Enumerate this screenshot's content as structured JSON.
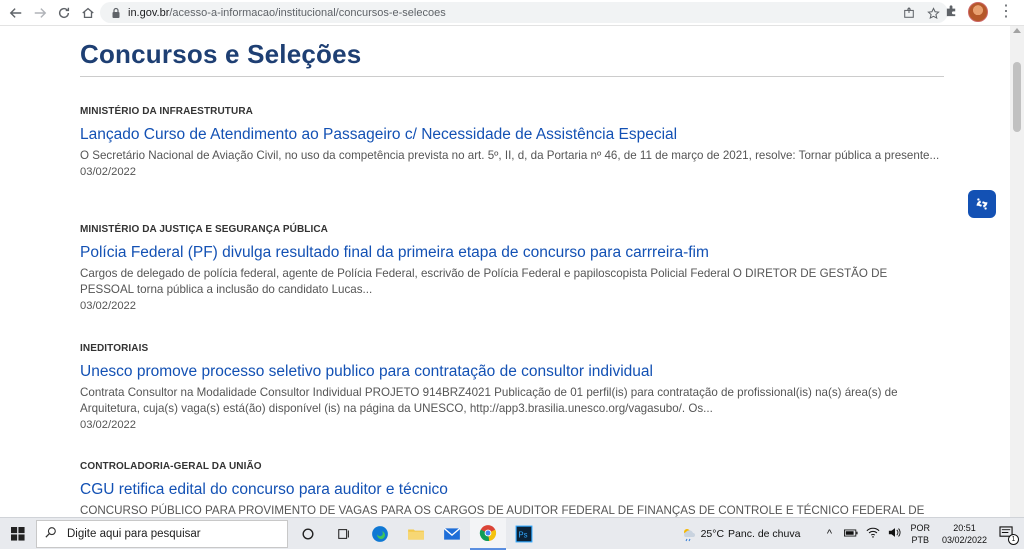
{
  "browser": {
    "url_host": "in.gov.br",
    "url_path": "/acesso-a-informacao/institucional/concursos-e-selecoes"
  },
  "page": {
    "title": "Concursos e Seleções"
  },
  "items": [
    {
      "category": "MINISTÉRIO DA INFRAESTRUTURA",
      "headline": "Lançado Curso de Atendimento ao Passageiro c/ Necessidade de Assistência Especial",
      "summary": "O Secretário Nacional de Aviação Civil, no uso da competência prevista no art. 5º, II, d, da Portaria nº 46, de 11 de março de 2021, resolve: Tornar pública a presente...",
      "date": "03/02/2022"
    },
    {
      "category": "MINISTÉRIO DA JUSTIÇA E SEGURANÇA PÚBLICA",
      "headline": "Polícia Federal (PF) divulga resultado final da primeira etapa de concurso para carrreira-fim",
      "summary": "Cargos de delegado de polícia federal, agente de Polícia Federal, escrivão de Polícia Federal e papiloscopista Policial Federal O DIRETOR DE GESTÃO DE PESSOAL torna pública a inclusão do candidato Lucas...",
      "date": "03/02/2022"
    },
    {
      "category": "INEDITORIAIS",
      "headline": "Unesco promove processo seletivo publico para contratação de consultor individual",
      "summary": "Contrata Consultor na Modalidade Consultor Individual PROJETO 914BRZ4021 Publicação de 01 perfil(is) para contratação de profissional(is) na(s) área(s) de Arquitetura, cuja(s) vaga(s) está(ão) disponível (is) na página da UNESCO, http://app3.brasilia.unesco.org/vagasubo/. Os...",
      "date": "03/02/2022"
    },
    {
      "category": "CONTROLADORIA-GERAL DA UNIÃO",
      "headline": "CGU retifica edital do concurso para auditor e técnico",
      "summary": "CONCURSO PÚBLICO PARA PROVIMENTO DE VAGAS PARA OS CARGOS DE AUDITOR FEDERAL DE FINANÇAS DE CONTROLE E TÉCNICO FEDERAL DE",
      "date": ""
    }
  ],
  "taskbar": {
    "search_placeholder": "Digite aqui para pesquisar",
    "weather_temp": "25°C",
    "weather_text": "Panc. de chuva",
    "lang_top": "POR",
    "lang_bottom": "PTB",
    "time": "20:51",
    "date": "03/02/2022",
    "notification_count": "1"
  },
  "colors": {
    "link": "#1351b4",
    "title": "#1e3f73",
    "accent": "#1351b4"
  }
}
